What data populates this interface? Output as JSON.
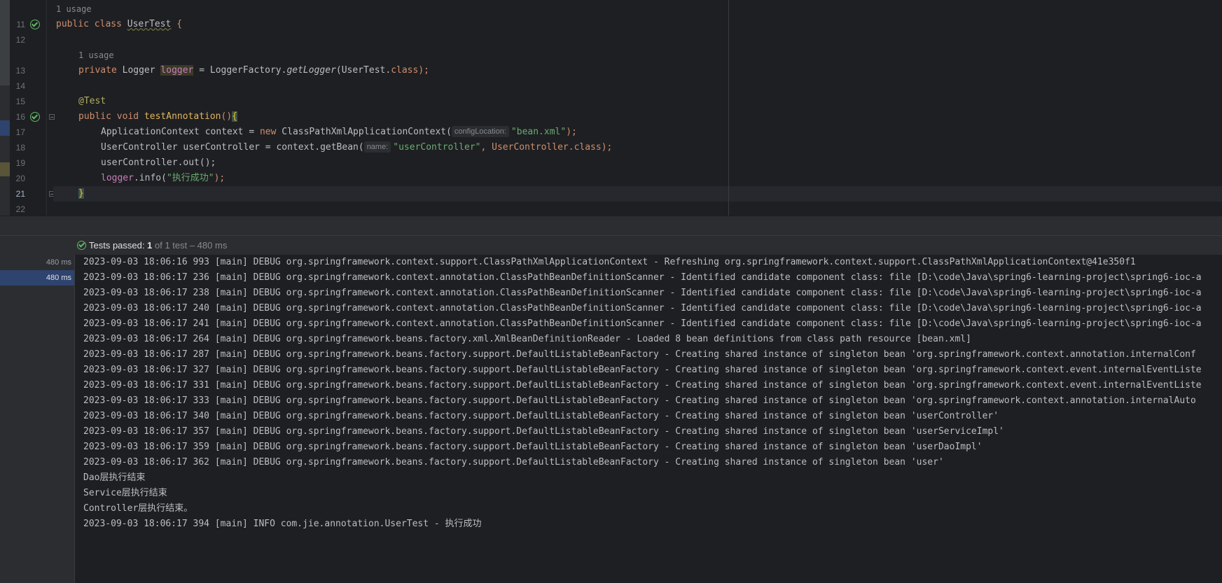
{
  "editor": {
    "usage_class": "1 usage",
    "usage_field": "1 usage",
    "line_numbers": [
      "11",
      "12",
      "13",
      "14",
      "15",
      "16",
      "17",
      "18",
      "19",
      "20",
      "21",
      "22"
    ],
    "line11": {
      "kw1": "public",
      "kw2": "class",
      "name": "UserTest",
      "rest": " {"
    },
    "line13": {
      "kw": "private",
      "type": " Logger ",
      "field": "logger",
      "mid": " = LoggerFactory.",
      "call": "getLogger",
      "args": "(UserTest.",
      "kwc": "class",
      "end": ");"
    },
    "line15": {
      "annotation": "@Test"
    },
    "line16": {
      "kw1": "public",
      "kw2": "void",
      "method": "testAnnotation",
      "paren": "()",
      "brace": "{"
    },
    "line17": {
      "pre": "ApplicationContext context = ",
      "kw": "new",
      "cls": " ClassPathXmlApplicationContext(",
      "hint": "configLocation:",
      "str": "\"bean.xml\"",
      "end": ");"
    },
    "line18": {
      "pre": "UserController userController = context.getBean(",
      "hint": "name:",
      "str": "\"userController\"",
      "mid": ", UserController.",
      "kwc": "class",
      "end": ");"
    },
    "line19": {
      "text": "userController.out();"
    },
    "line20": {
      "field": "logger",
      "mid": ".info(",
      "str": "\"执行成功\"",
      "end": ");"
    },
    "line21": {
      "brace": "}"
    }
  },
  "test_bar": {
    "label": "Tests passed:",
    "count": "1",
    "rest": "of 1 test – 480 ms"
  },
  "tree": {
    "rows": [
      "480 ms",
      "480 ms"
    ]
  },
  "console": {
    "lines": [
      "2023-09-03 18:06:16 993 [main] DEBUG org.springframework.context.support.ClassPathXmlApplicationContext - Refreshing org.springframework.context.support.ClassPathXmlApplicationContext@41e350f1",
      "2023-09-03 18:06:17 236 [main] DEBUG org.springframework.context.annotation.ClassPathBeanDefinitionScanner - Identified candidate component class: file [D:\\code\\Java\\spring6-learning-project\\spring6-ioc-a",
      "2023-09-03 18:06:17 238 [main] DEBUG org.springframework.context.annotation.ClassPathBeanDefinitionScanner - Identified candidate component class: file [D:\\code\\Java\\spring6-learning-project\\spring6-ioc-a",
      "2023-09-03 18:06:17 240 [main] DEBUG org.springframework.context.annotation.ClassPathBeanDefinitionScanner - Identified candidate component class: file [D:\\code\\Java\\spring6-learning-project\\spring6-ioc-a",
      "2023-09-03 18:06:17 241 [main] DEBUG org.springframework.context.annotation.ClassPathBeanDefinitionScanner - Identified candidate component class: file [D:\\code\\Java\\spring6-learning-project\\spring6-ioc-a",
      "2023-09-03 18:06:17 264 [main] DEBUG org.springframework.beans.factory.xml.XmlBeanDefinitionReader - Loaded 8 bean definitions from class path resource [bean.xml]",
      "2023-09-03 18:06:17 287 [main] DEBUG org.springframework.beans.factory.support.DefaultListableBeanFactory - Creating shared instance of singleton bean 'org.springframework.context.annotation.internalConf",
      "2023-09-03 18:06:17 327 [main] DEBUG org.springframework.beans.factory.support.DefaultListableBeanFactory - Creating shared instance of singleton bean 'org.springframework.context.event.internalEventListe",
      "2023-09-03 18:06:17 331 [main] DEBUG org.springframework.beans.factory.support.DefaultListableBeanFactory - Creating shared instance of singleton bean 'org.springframework.context.event.internalEventListe",
      "2023-09-03 18:06:17 333 [main] DEBUG org.springframework.beans.factory.support.DefaultListableBeanFactory - Creating shared instance of singleton bean 'org.springframework.context.annotation.internalAuto",
      "2023-09-03 18:06:17 340 [main] DEBUG org.springframework.beans.factory.support.DefaultListableBeanFactory - Creating shared instance of singleton bean 'userController'",
      "2023-09-03 18:06:17 357 [main] DEBUG org.springframework.beans.factory.support.DefaultListableBeanFactory - Creating shared instance of singleton bean 'userServiceImpl'",
      "2023-09-03 18:06:17 359 [main] DEBUG org.springframework.beans.factory.support.DefaultListableBeanFactory - Creating shared instance of singleton bean 'userDaoImpl'",
      "2023-09-03 18:06:17 362 [main] DEBUG org.springframework.beans.factory.support.DefaultListableBeanFactory - Creating shared instance of singleton bean 'user'",
      "Dao层执行结束",
      "Service层执行结束",
      "Controller层执行结束。",
      "2023-09-03 18:06:17 394 [main] INFO com.jie.annotation.UserTest - 执行成功"
    ]
  },
  "colors": {
    "keyword": "#cf8e6d",
    "string": "#6aab73",
    "pass": "#5fb865",
    "selection": "#2e436e"
  }
}
